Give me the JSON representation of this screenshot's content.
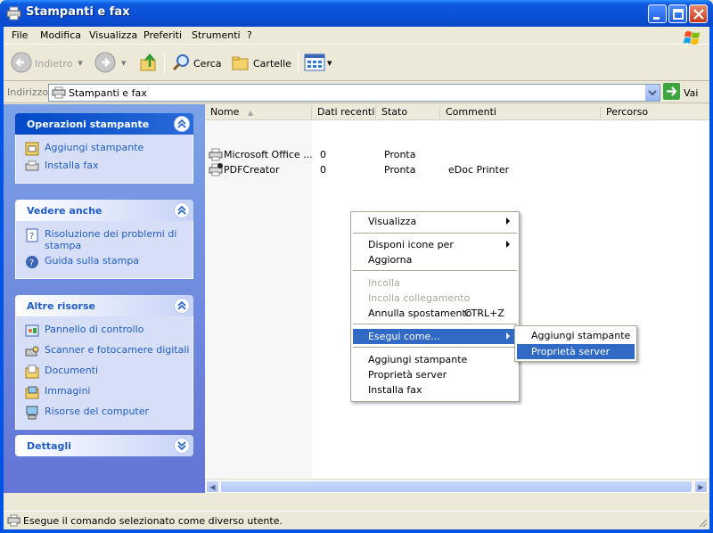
{
  "window": {
    "title": "Stampanti e fax",
    "icon": "printer-fax-icon"
  },
  "menubar": {
    "items": [
      "File",
      "Modifica",
      "Visualizza",
      "Preferiti",
      "Strumenti",
      "?"
    ]
  },
  "toolbar": {
    "back_label": "Indietro",
    "search_label": "Cerca",
    "folders_label": "Cartelle"
  },
  "address": {
    "label": "Indirizzo",
    "value": "Stampanti e fax",
    "go_label": "Vai"
  },
  "taskpane": {
    "printer_tasks": {
      "title": "Operazioni stampante",
      "items": [
        {
          "label": "Aggiungi stampante",
          "icon": "add-printer-icon"
        },
        {
          "label": "Installa fax",
          "icon": "fax-icon"
        }
      ]
    },
    "see_also": {
      "title": "Vedere anche",
      "items": [
        {
          "label": "Risoluzione dei problemi di stampa",
          "icon": "help-book-icon"
        },
        {
          "label": "Guida sulla stampa",
          "icon": "help-icon"
        }
      ]
    },
    "other_places": {
      "title": "Altre risorse",
      "items": [
        {
          "label": "Pannello di controllo",
          "icon": "control-panel-icon"
        },
        {
          "label": "Scanner e fotocamere digitali",
          "icon": "scanner-camera-icon"
        },
        {
          "label": "Documenti",
          "icon": "documents-folder-icon"
        },
        {
          "label": "Immagini",
          "icon": "pictures-folder-icon"
        },
        {
          "label": "Risorse del computer",
          "icon": "my-computer-icon"
        }
      ]
    },
    "details": {
      "title": "Dettagli"
    }
  },
  "list": {
    "columns": [
      "Nome",
      "Dati recenti",
      "Stato",
      "Commenti",
      "Percorso"
    ],
    "rows": [
      {
        "name": "Microsoft Office ...",
        "recent": "0",
        "status": "Pronta",
        "comment": "",
        "path": ""
      },
      {
        "name": "PDFCreator",
        "recent": "0",
        "status": "Pronta",
        "comment": "eDoc Printer",
        "path": ""
      }
    ]
  },
  "context_menu": {
    "items": [
      {
        "label": "Visualizza",
        "submenu": true
      },
      {
        "label": "Disponi icone per",
        "submenu": true
      },
      {
        "label": "Aggiorna"
      },
      {
        "label": "Incolla",
        "disabled": true
      },
      {
        "label": "Incolla collegamento",
        "disabled": true
      },
      {
        "label": "Annulla spostamento",
        "shortcut": "CTRL+Z"
      },
      {
        "label": "Esegui come...",
        "submenu": true,
        "highlighted": true
      },
      {
        "label": "Aggiungi stampante"
      },
      {
        "label": "Proprietà server"
      },
      {
        "label": "Installa fax"
      }
    ],
    "submenu": [
      {
        "label": "Aggiungi stampante"
      },
      {
        "label": "Proprietà server",
        "highlighted": true
      }
    ]
  },
  "statusbar": {
    "text": "Esegue il comando selezionato come diverso utente."
  },
  "colors": {
    "titlebar": "#0A4FD6",
    "highlight": "#316AC5",
    "taskpane_link": "#215DC6"
  }
}
